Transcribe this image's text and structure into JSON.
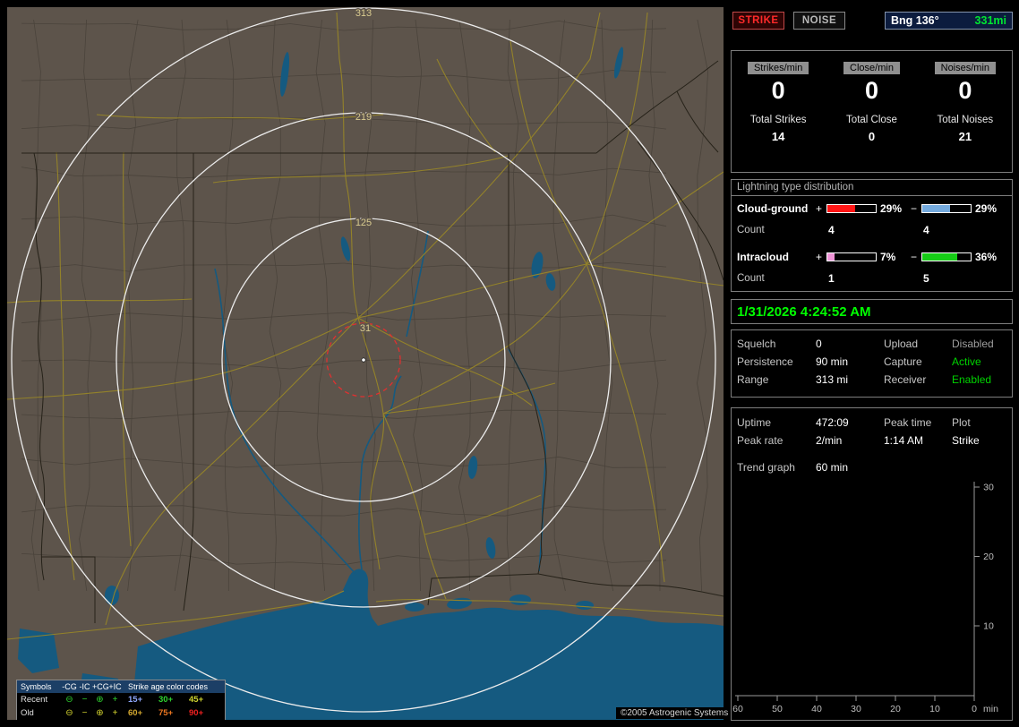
{
  "topbar": {
    "strike_label": "STRIKE",
    "noise_label": "NOISE",
    "bearing_label": "Bng 136°",
    "distance_label": "331mi",
    "distance_color": "#00e531"
  },
  "counters": {
    "columns": [
      {
        "rate_label": "Strikes/min",
        "rate": "0",
        "total_label": "Total Strikes",
        "total": "14"
      },
      {
        "rate_label": "Close/min",
        "rate": "0",
        "total_label": "Total Close",
        "total": "0"
      },
      {
        "rate_label": "Noises/min",
        "rate": "0",
        "total_label": "Total Noises",
        "total": "21"
      }
    ]
  },
  "distribution": {
    "title": "Lightning type distribution",
    "plus": "+",
    "minus": "−",
    "count_label": "Count",
    "rows": [
      {
        "name": "Cloud-ground",
        "pos_pct": 29,
        "pos_pct_label": "29%",
        "pos_color": "#ff1515",
        "pos_count": "4",
        "neg_pct": 29,
        "neg_pct_label": "29%",
        "neg_color": "#74aade",
        "neg_count": "4"
      },
      {
        "name": "Intracloud",
        "pos_pct": 7,
        "pos_pct_label": "7%",
        "pos_color": "#f095d8",
        "pos_count": "1",
        "neg_pct": 36,
        "neg_pct_label": "36%",
        "neg_color": "#16cc16",
        "neg_count": "5"
      }
    ]
  },
  "clock": {
    "value": "1/31/2026 4:24:52 AM",
    "color": "#00ff00"
  },
  "settings": {
    "rows": [
      {
        "l1": "Squelch",
        "v1": "0",
        "l2": "Upload",
        "v2": "Disabled",
        "v2_color": "#9f9f9f"
      },
      {
        "l1": "Persistence",
        "v1": "90 min",
        "l2": "Capture",
        "v2": "Active",
        "v2_color": "#00d400"
      },
      {
        "l1": "Range",
        "v1": "313 mi",
        "l2": "Receiver",
        "v2": "Enabled",
        "v2_color": "#00d400"
      }
    ]
  },
  "stats": {
    "uptime_label": "Uptime",
    "uptime_value": "472:09",
    "peak_time_label": "Peak time",
    "plot_label": "Plot",
    "peak_rate_label": "Peak rate",
    "peak_rate_value": "2/min",
    "peak_time_value": "1:14 AM",
    "plot_value": "Strike"
  },
  "trend": {
    "label": "Trend graph",
    "value": "60 min",
    "x_ticks": [
      "60",
      "50",
      "40",
      "30",
      "20",
      "10",
      "0"
    ],
    "x_unit": "min",
    "y_ticks": [
      "30",
      "20",
      "10"
    ]
  },
  "map": {
    "rings": [
      {
        "label": "313"
      },
      {
        "label": "219"
      },
      {
        "label": "125"
      },
      {
        "label": "31"
      }
    ],
    "copyright": "©2005 Astrogenic Systems",
    "legend": {
      "symbols_title": "Symbols",
      "columns": [
        "-CG",
        "-IC",
        "+CG",
        "+IC"
      ],
      "symbols": [
        "⊖",
        "−",
        "⊕",
        "+"
      ],
      "age_title": "Strike age color codes",
      "rows": [
        {
          "name": "Recent",
          "symbol_color": "#2fd42f",
          "ages": [
            {
              "label": "15+",
              "color": "#8fa8ff"
            },
            {
              "label": "30+",
              "color": "#2fd42f"
            },
            {
              "label": "45+",
              "color": "#cfd42f"
            }
          ]
        },
        {
          "name": "Old",
          "symbol_color": "#d4d42f",
          "ages": [
            {
              "label": "60+",
              "color": "#d4a82f"
            },
            {
              "label": "75+",
              "color": "#f07820"
            },
            {
              "label": "90+",
              "color": "#f02020"
            }
          ]
        }
      ]
    }
  }
}
